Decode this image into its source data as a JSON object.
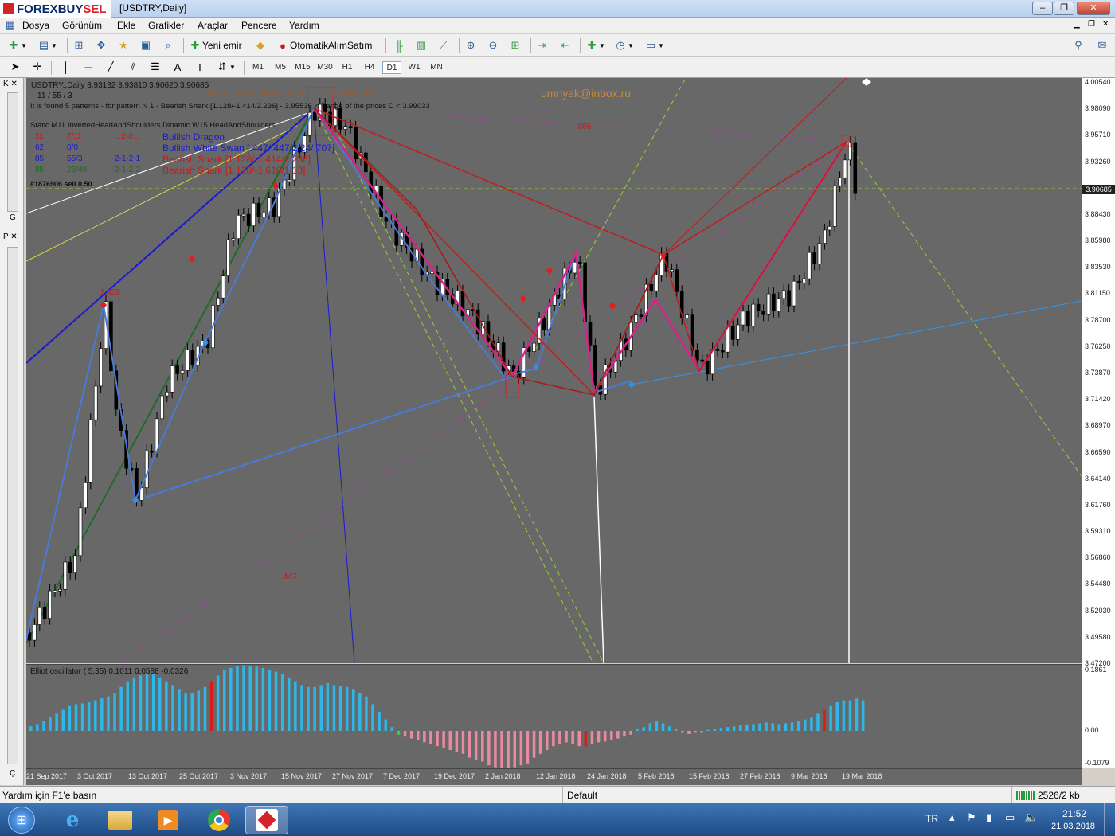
{
  "window": {
    "brand_main": "FOREX",
    "brand_buy": "BUY",
    "brand_sell": "SEL",
    "title": "[USDTRY,Daily]",
    "minimize": "–",
    "restore": "❐",
    "close": "✕"
  },
  "menu": {
    "items": [
      "Dosya",
      "Görünüm",
      "Ekle",
      "Grafikler",
      "Araçlar",
      "Pencere",
      "Yardım"
    ]
  },
  "toolbar": {
    "new_order": "Yeni emir",
    "auto_trading": "OtomatikAlımSatım",
    "timeframes": [
      "M1",
      "M5",
      "M15",
      "M30",
      "H1",
      "H4",
      "D1",
      "W1",
      "MN"
    ],
    "active_timeframe": "D1"
  },
  "chart": {
    "symbol_line": "USDTRY.,Daily  3.93132 3.93810 3.90620 3.90685",
    "counter_line": "11 / 55 / 3",
    "found_line": "It is found 5 patterns  -  for pattern N 1 - Bearish Shark [1.128/-1.414/2.236] - 3.95536 < Range of the prices D < 3.99033",
    "indicator_title": "Waves Auto Trend Indicator - Durko Ltd",
    "email": "umnyak@inbox.ru",
    "table_header": "Static   M11   InvertedHeadAndShoulders  Dinamic  W15  HeadAndShoulders",
    "rows": [
      {
        "a": "31",
        "b": "7/11",
        "c": "...2-0...",
        "name": "Bullish Dragon",
        "color": "#1a1ad6"
      },
      {
        "a": "62",
        "b": "0/0",
        "c": "",
        "name": "Bullish White Swan [.447/.447/2.24/.707]",
        "color": "#1a1ad6"
      },
      {
        "a": "85",
        "b": "55/3",
        "c": "2-1-2-1",
        "name": "Bearish Shark [1.128/-1.414/2.236]",
        "color": "#c31c1c"
      },
      {
        "a": "85",
        "b": "25/40",
        "c": "2-1-2-2",
        "name": "Bearish Shark [1.128/-1.618/1.13]",
        "color": "#c31c1c"
      }
    ],
    "order_label": "#1876906 sell 0.50",
    "label_886": ".886",
    "label_447": ".447",
    "label_1438": "1.438",
    "current_price": "3.90685",
    "price_ticks": [
      "4.00540",
      "3.98090",
      "3.95710",
      "3.93260",
      "3.90810",
      "3.88430",
      "3.85980",
      "3.83530",
      "3.81150",
      "3.78700",
      "3.76250",
      "3.73870",
      "3.71420",
      "3.68970",
      "3.66590",
      "3.64140",
      "3.61760",
      "3.59310",
      "3.56860",
      "3.54480",
      "3.52030",
      "3.49580",
      "3.47200"
    ]
  },
  "oscillator": {
    "title": "Elliot oscillator ( 5,35) 0.1011 0.0588 -0.0326",
    "ticks": [
      "0.1861",
      "0.00",
      "-0.1079"
    ],
    "values": [
      0.012,
      0.018,
      0.025,
      0.035,
      0.045,
      0.055,
      0.065,
      0.07,
      0.072,
      0.075,
      0.08,
      0.085,
      0.09,
      0.1,
      0.115,
      0.13,
      0.14,
      0.145,
      0.15,
      0.148,
      0.14,
      0.13,
      0.12,
      0.11,
      0.1,
      0.1,
      0.105,
      0.115,
      0.13,
      0.145,
      0.16,
      0.165,
      0.17,
      0.172,
      0.17,
      0.168,
      0.165,
      0.16,
      0.155,
      0.15,
      0.14,
      0.13,
      0.12,
      0.115,
      0.115,
      0.12,
      0.125,
      0.12,
      0.118,
      0.115,
      0.11,
      0.1,
      0.09,
      0.07,
      0.05,
      0.03,
      0.01,
      -0.01,
      -0.015,
      -0.02,
      -0.025,
      -0.03,
      -0.035,
      -0.04,
      -0.045,
      -0.05,
      -0.055,
      -0.06,
      -0.07,
      -0.075,
      -0.08,
      -0.09,
      -0.095,
      -0.1,
      -0.1,
      -0.095,
      -0.09,
      -0.085,
      -0.07,
      -0.06,
      -0.05,
      -0.04,
      -0.035,
      -0.03,
      -0.035,
      -0.04,
      -0.04,
      -0.035,
      -0.03,
      -0.028,
      -0.025,
      -0.02,
      -0.015,
      -0.01,
      0.005,
      0.01,
      0.02,
      0.025,
      0.02,
      0.012,
      0.005,
      -0.005,
      -0.008,
      -0.005,
      -0.005,
      0.003,
      0.006,
      0.008,
      0.01,
      0.012,
      0.015,
      0.017,
      0.018,
      0.02,
      0.022,
      0.02,
      0.018,
      0.02,
      0.022,
      0.025,
      0.03,
      0.035,
      0.045,
      0.055,
      0.065,
      0.075,
      0.08,
      0.08,
      0.085,
      0.08
    ],
    "red_bars": [
      28,
      86,
      123
    ],
    "green_bars": [
      57
    ]
  },
  "time_axis": {
    "labels": [
      "21 Sep 2017",
      "3 Oct 2017",
      "13 Oct 2017",
      "25 Oct 2017",
      "3 Nov 2017",
      "15 Nov 2017",
      "27 Nov 2017",
      "7 Dec 2017",
      "19 Dec 2017",
      "2 Jan 2018",
      "12 Jan 2018",
      "24 Jan 2018",
      "5 Feb 2018",
      "15 Feb 2018",
      "27 Feb 2018",
      "9 Mar 2018",
      "19 Mar 2018"
    ]
  },
  "statusbar": {
    "help": "Yardım için F1'e basın",
    "profile": "Default",
    "traffic": "2526/2 kb"
  },
  "taskbar": {
    "lang": "TR",
    "time": "21:52",
    "date": "21.03.2018"
  },
  "colors": {
    "chart_bg": "#686868",
    "bull_candle": "#ffffff",
    "bear_candle": "#000000",
    "osc_positive": "#2fb6e8",
    "osc_negative": "#e98aa0",
    "osc_red": "#d81b1b",
    "osc_green": "#2bd84a"
  }
}
